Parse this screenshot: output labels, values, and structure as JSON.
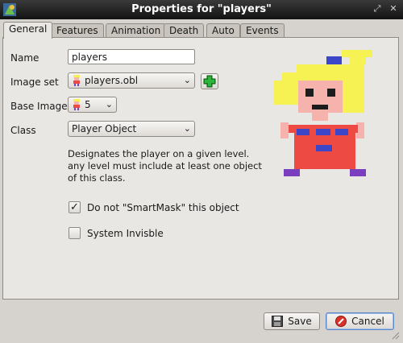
{
  "window": {
    "title": "Properties for \"players\"",
    "controls": {
      "restore": "⤢",
      "close": "✕"
    }
  },
  "tabs": [
    {
      "label": "General",
      "active": true
    },
    {
      "label": "Features",
      "active": false
    },
    {
      "label": "Animation",
      "active": false
    },
    {
      "label": "Death",
      "active": false
    },
    {
      "label": "Auto",
      "active": false
    },
    {
      "label": "Events",
      "active": false
    }
  ],
  "form": {
    "name_label": "Name",
    "name_value": "players",
    "imageset_label": "Image set",
    "imageset_value": "players.obl",
    "baseimage_label": "Base Image",
    "baseimage_value": "5",
    "class_label": "Class",
    "class_value": "Player Object",
    "description": "Designates the player on a given level. any level must include at least one object of this class.",
    "smartmask_label": "Do not \"SmartMask\" this object",
    "smartmask_checked": true,
    "invisible_label": "System Invisble",
    "invisible_checked": false
  },
  "buttons": {
    "save": "Save",
    "cancel": "Cancel"
  },
  "colors": {
    "hair": "#f7f253",
    "skin": "#f6b3ae",
    "shirt": "#ee4a44",
    "blue": "#3b46c9",
    "purple": "#7a3fbf",
    "green": "#1e9e2a"
  }
}
